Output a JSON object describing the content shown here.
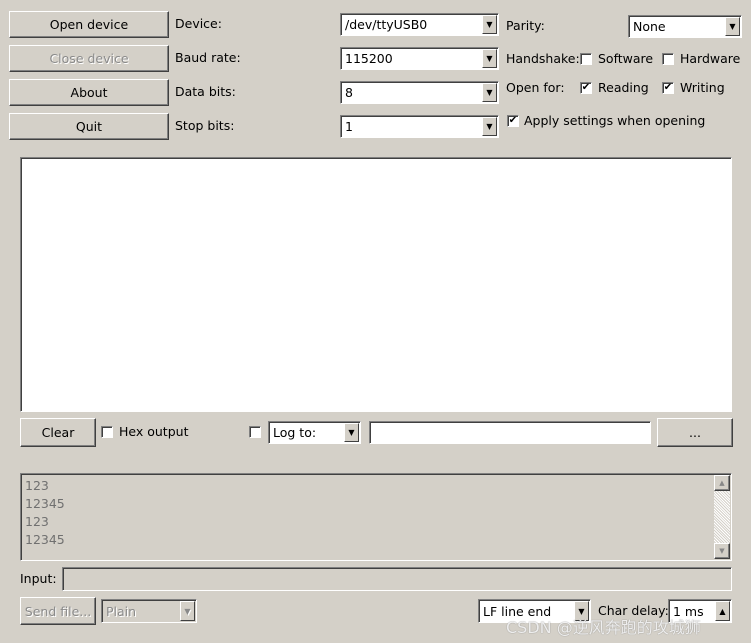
{
  "buttons": {
    "open": "Open device",
    "close": "Close device",
    "about": "About",
    "quit": "Quit",
    "clear": "Clear",
    "browse": "...",
    "send_file": "Send file..."
  },
  "labels": {
    "device": "Device:",
    "baud": "Baud rate:",
    "data_bits": "Data bits:",
    "stop_bits": "Stop bits:",
    "parity": "Parity:",
    "handshake": "Handshake:",
    "open_for": "Open for:",
    "input": "Input:",
    "char_delay": "Char delay:"
  },
  "combos": {
    "device": "/dev/ttyUSB0",
    "baud": "115200",
    "data_bits": "8",
    "stop_bits": "1",
    "parity": "None",
    "log": "Log to:",
    "send_mode": "Plain",
    "line_end": "LF line end"
  },
  "checks": {
    "software": {
      "label": "Software",
      "checked": false
    },
    "hardware": {
      "label": "Hardware",
      "checked": false
    },
    "reading": {
      "label": "Reading",
      "checked": true
    },
    "writing": {
      "label": "Writing",
      "checked": true
    },
    "apply": {
      "label": "Apply settings when opening",
      "checked": true
    },
    "hex": {
      "label": "Hex output",
      "checked": false
    },
    "log": {
      "checked": false
    }
  },
  "log_file": "",
  "input_value": "",
  "char_delay_value": "1 ms",
  "history": [
    "123",
    "12345",
    "123",
    "12345"
  ],
  "watermark": "CSDN @逆风奔跑的攻城狮"
}
